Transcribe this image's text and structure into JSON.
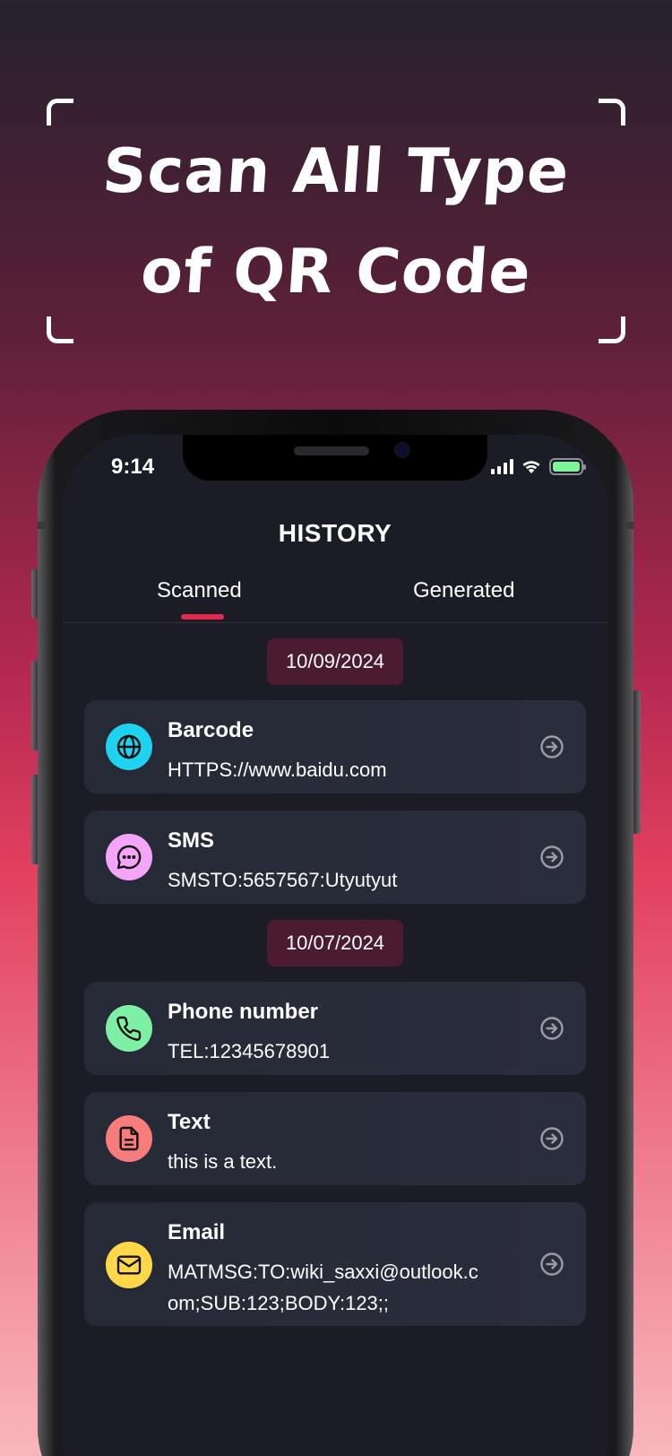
{
  "headline": {
    "line1": "Scan All Type",
    "line2": "of QR Code"
  },
  "status_bar": {
    "time": "9:14"
  },
  "page": {
    "title": "HISTORY"
  },
  "tabs": [
    {
      "label": "Scanned",
      "active": true
    },
    {
      "label": "Generated",
      "active": false
    }
  ],
  "groups": [
    {
      "date": "10/09/2024",
      "items": [
        {
          "type": "Barcode",
          "value": "HTTPS://www.baidu.com",
          "icon": "globe-icon",
          "icon_color": "#1fd3f0"
        },
        {
          "type": "SMS",
          "value": "SMSTO:5657567:Utyutyut",
          "icon": "message-icon",
          "icon_color": "#f4a5f7"
        }
      ]
    },
    {
      "date": "10/07/2024",
      "items": [
        {
          "type": "Phone number",
          "value": "TEL:12345678901",
          "icon": "phone-icon",
          "icon_color": "#7ef0a6"
        },
        {
          "type": "Text",
          "value": "this is a text.",
          "icon": "document-icon",
          "icon_color": "#f87c7c"
        },
        {
          "type": "Email",
          "value": "MATMSG:TO:wiki_saxxi@outlook.com;SUB:123;BODY:123;;",
          "icon": "mail-icon",
          "icon_color": "#ffd84a"
        }
      ]
    }
  ],
  "colors": {
    "accent": "#e6284f",
    "date_chip": "#4b1b30",
    "card": "#282b39",
    "screen": "#1b1c26"
  }
}
